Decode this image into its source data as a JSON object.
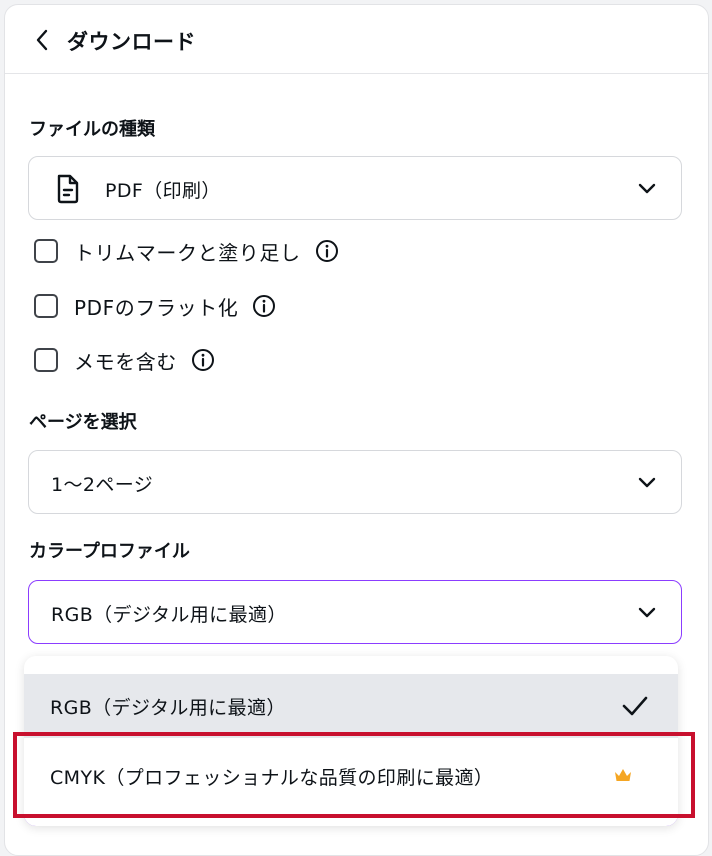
{
  "header": {
    "title": "ダウンロード"
  },
  "file_type": {
    "label": "ファイルの種類",
    "selected": "PDF（印刷）",
    "icon": "document-icon"
  },
  "options": [
    {
      "label": "トリムマークと塗り足し",
      "checked": false
    },
    {
      "label": "PDFのフラット化",
      "checked": false
    },
    {
      "label": "メモを含む",
      "checked": false
    }
  ],
  "pages": {
    "label": "ページを選択",
    "selected": "1〜2ページ"
  },
  "color_profile": {
    "label": "カラープロファイル",
    "selected": "RGB（デジタル用に最適）",
    "dropdown": [
      {
        "label": "RGB（デジタル用に最適）",
        "selected": true
      },
      {
        "label": "CMYK（プロフェッショナルな品質の印刷に最適）",
        "selected": false,
        "premium": true
      }
    ]
  },
  "colors": {
    "accent": "#8b3dff",
    "highlight": "#c8102e",
    "crown": "#f5a623"
  }
}
